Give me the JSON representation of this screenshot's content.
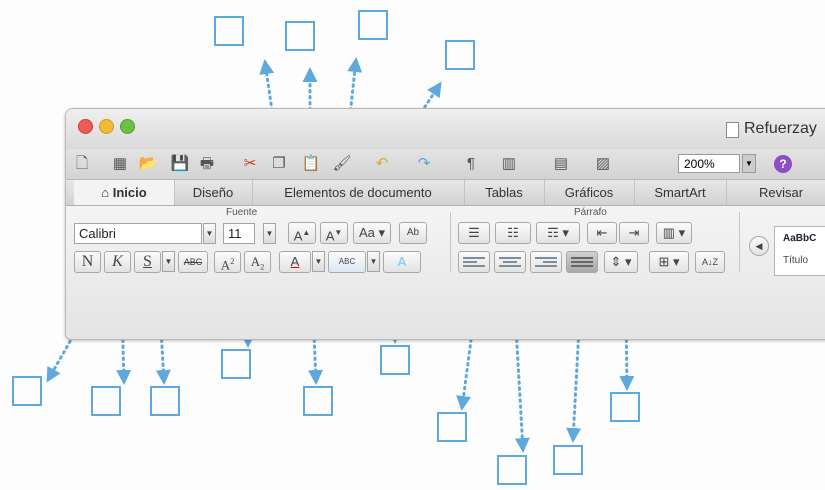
{
  "window": {
    "title": "Refuerzay"
  },
  "toolbar": {
    "zoom": "200%"
  },
  "tabs": [
    "Inicio",
    "Diseño",
    "Elementos de documento",
    "Tablas",
    "Gráficos",
    "SmartArt",
    "Revisar"
  ],
  "ribbon": {
    "font_group_title": "Fuente",
    "paragraph_group_title": "Párrafo",
    "font_name": "Calibri",
    "font_size": "11",
    "bold_label": "N",
    "italic_label": "K",
    "underline_label": "S",
    "strike_label": "ABC",
    "style_preview": "AaBbC",
    "style_name": "Título"
  },
  "colors": {
    "callout": "#5fa8dd",
    "active_tab": "#f3f3f3"
  }
}
